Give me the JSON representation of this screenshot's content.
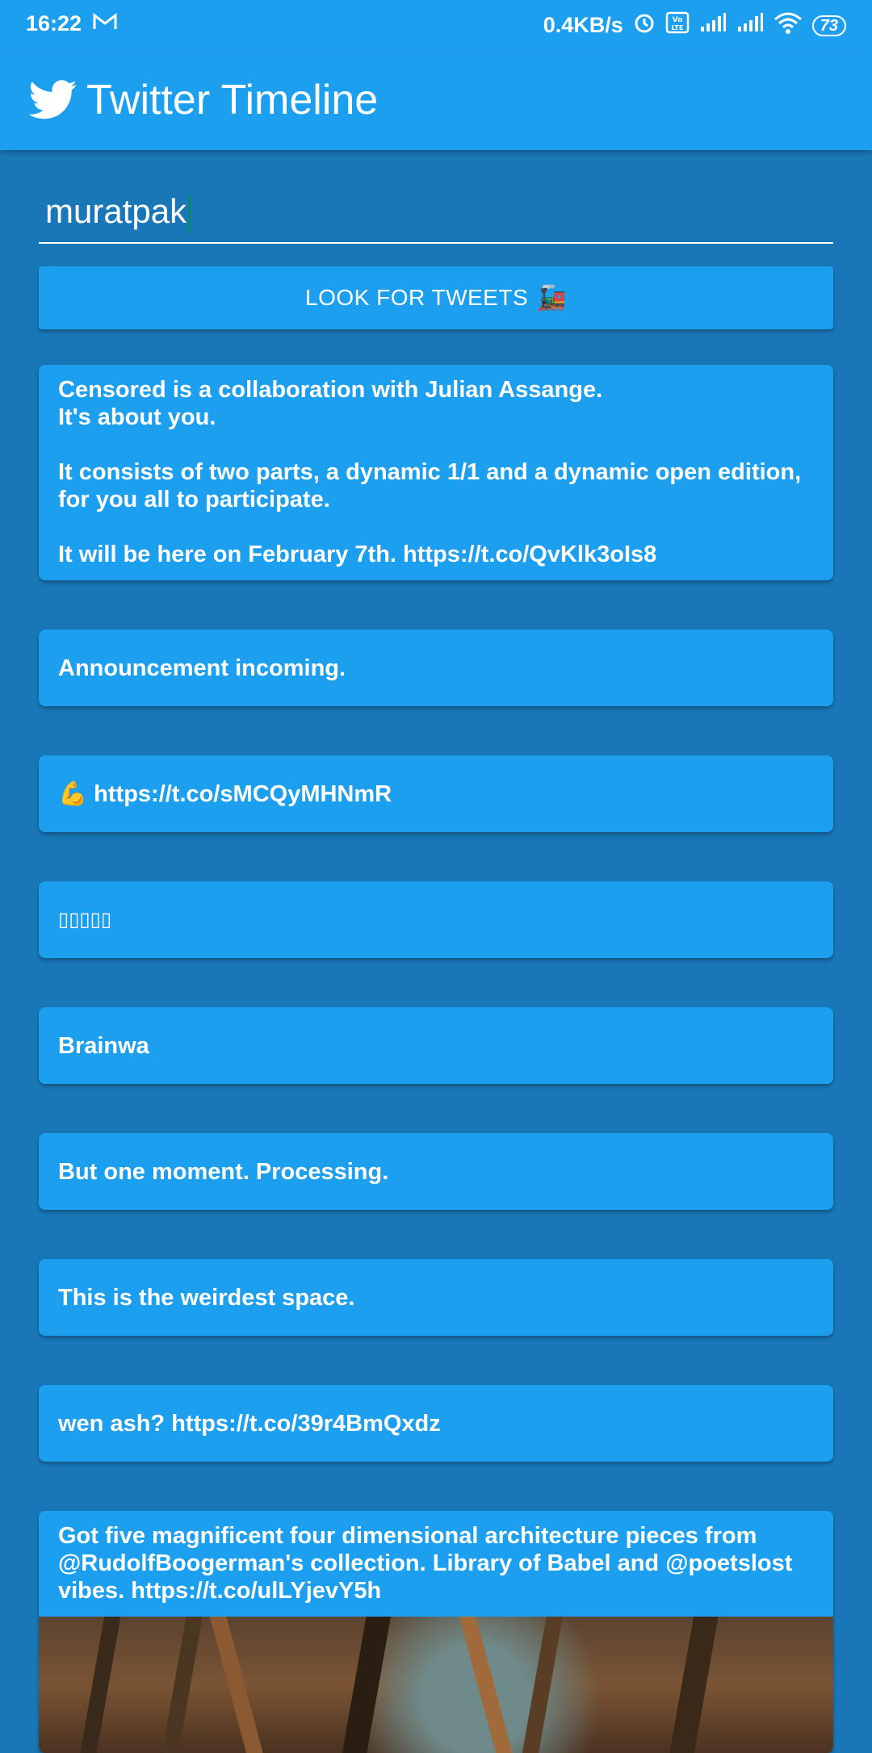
{
  "status_bar": {
    "time": "16:22",
    "mail_icon": "gmail-icon",
    "network_speed": "0.4KB/s",
    "battery": "73"
  },
  "app_bar": {
    "title": "Twitter Timeline",
    "icon": "twitter-bird-icon"
  },
  "search": {
    "value": "muratpak"
  },
  "look_button": {
    "label": "LOOK FOR TWEETS",
    "icon": "🚂"
  },
  "tweets": [
    {
      "text": "Censored is a collaboration with Julian Assange.\nIt's about you.\n\nIt consists of two parts, a dynamic 1/1 and a dynamic open edition, for you all to participate.\n\nIt will be here on February 7th. https://t.co/QvKlk3oIs8"
    },
    {
      "text": "Announcement incoming."
    },
    {
      "text": "💪 https://t.co/sMCQyMHNmR"
    },
    {
      "text": "▯▯▯▯▯"
    },
    {
      "text": "Brainwa"
    },
    {
      "text": "But one moment. Processing."
    },
    {
      "text": "This is the weirdest space."
    },
    {
      "text": "wen ash? https://t.co/39r4BmQxdz"
    },
    {
      "text": "Got five magnificent four dimensional architecture pieces from @RudolfBoogerman's collection. Library of Babel and @poetslost vibes. https://t.co/ulLYjevY5h"
    }
  ]
}
